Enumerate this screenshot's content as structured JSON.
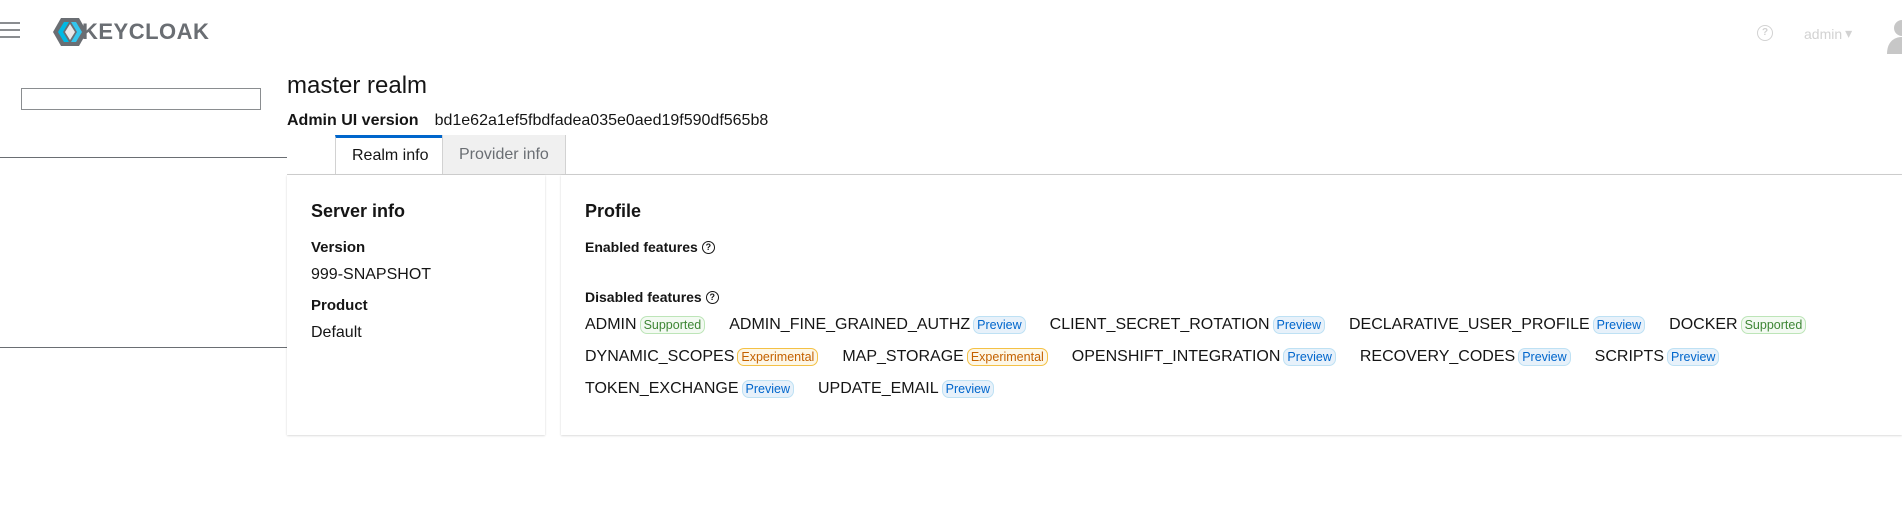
{
  "header": {
    "brand": "KEYCLOAK",
    "user": "admin",
    "icons": {
      "menu": "hamburger-icon",
      "help": "help-icon",
      "avatar": "avatar-icon"
    }
  },
  "sidebar": {
    "realm_input_value": ""
  },
  "page": {
    "title": "master realm",
    "version_label": "Admin UI version",
    "version_value": "bd1e62a1ef5fbdfadea035e0aed19f590df565b8"
  },
  "tabs": [
    "Realm info",
    "Provider info"
  ],
  "server_info": {
    "title": "Server info",
    "version_label": "Version",
    "version_value": "999-SNAPSHOT",
    "product_label": "Product",
    "product_value": "Default"
  },
  "profile": {
    "title": "Profile",
    "enabled_label": "Enabled features",
    "disabled_label": "Disabled features",
    "disabled_features": [
      [
        {
          "name": "ADMIN",
          "badge": "Supported"
        },
        {
          "name": "ADMIN_FINE_GRAINED_AUTHZ",
          "badge": "Preview"
        },
        {
          "name": "CLIENT_SECRET_ROTATION",
          "badge": "Preview"
        },
        {
          "name": "DECLARATIVE_USER_PROFILE",
          "badge": "Preview"
        },
        {
          "name": "DOCKER",
          "badge": "Supported"
        }
      ],
      [
        {
          "name": "DYNAMIC_SCOPES",
          "badge": "Experimental"
        },
        {
          "name": "MAP_STORAGE",
          "badge": "Experimental"
        },
        {
          "name": "OPENSHIFT_INTEGRATION",
          "badge": "Preview"
        },
        {
          "name": "RECOVERY_CODES",
          "badge": "Preview"
        },
        {
          "name": "SCRIPTS",
          "badge": "Preview"
        }
      ],
      [
        {
          "name": "TOKEN_EXCHANGE",
          "badge": "Preview"
        },
        {
          "name": "UPDATE_EMAIL",
          "badge": "Preview"
        }
      ]
    ]
  },
  "colors": {
    "accent": "#0066cc",
    "preview": "#0066cc",
    "supported": "#3e8635",
    "experimental": "#c46100"
  }
}
